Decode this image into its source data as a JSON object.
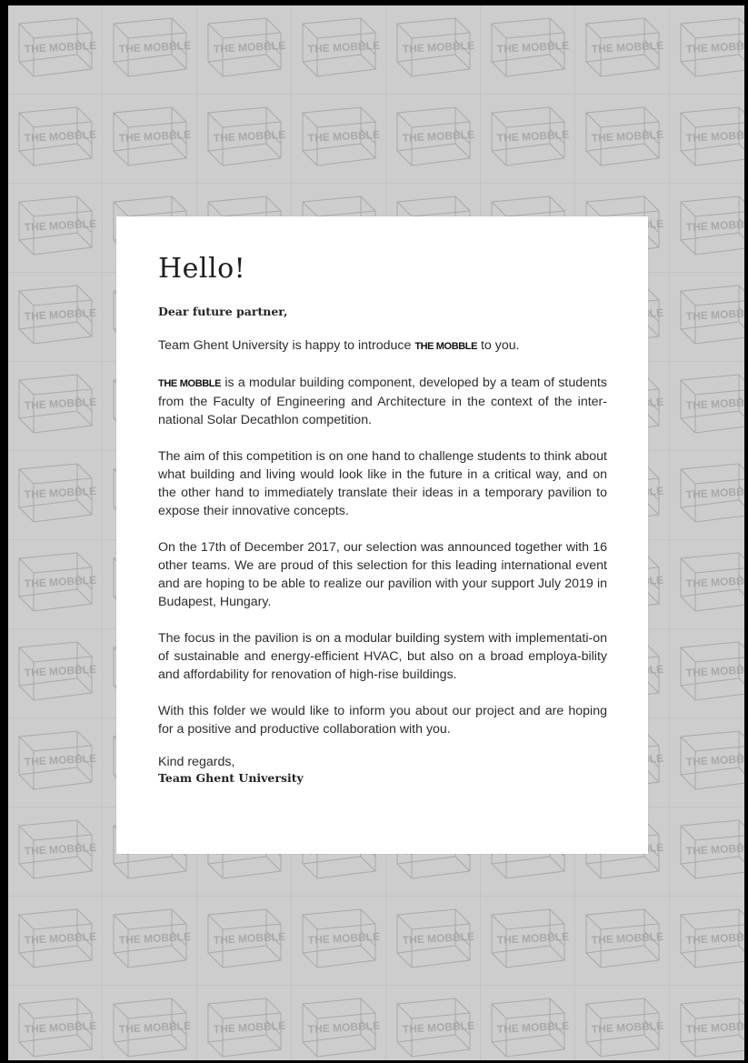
{
  "pattern": {
    "logo_text": "THE MOBBLE",
    "tile_color": "#cdcdcd",
    "logo_color": "#a9a9a9"
  },
  "letter": {
    "heading": "Hello!",
    "salutation": "Dear future partner,",
    "intro_before": "Team Ghent University is happy to introduce ",
    "intro_brand": "THE MOBBLE",
    "intro_after": " to you.",
    "p2_brand": "THE MOBBLE",
    "p2_text": " is a modular building component, developed by a team of students from the Faculty of Engineering and Architecture in the context of the inter-national Solar Decathlon competition.",
    "p3": "The aim of this competition is on one hand to challenge students to think about what building and living would look like in the future in a critical way, and on the other hand to immediately translate their ideas in a temporary pavilion to expose their innovative concepts.",
    "p4": "On the 17th of December 2017, our selection was announced together with 16 other teams. We are proud of this selection for this leading international event and are hoping to be able to realize our pavilion with your support July 2019 in Budapest, Hungary.",
    "p5": "The focus in the pavilion is on a modular building system with implementati-on of sustainable and energy-efficient HVAC, but also on a broad employa-bility and affordability for renovation of high-rise buildings.",
    "p6": "With this folder we would like to inform you about our project and are hoping for a positive and productive collaboration with you.",
    "signoff": "Kind regards,",
    "signature": "Team Ghent University"
  }
}
